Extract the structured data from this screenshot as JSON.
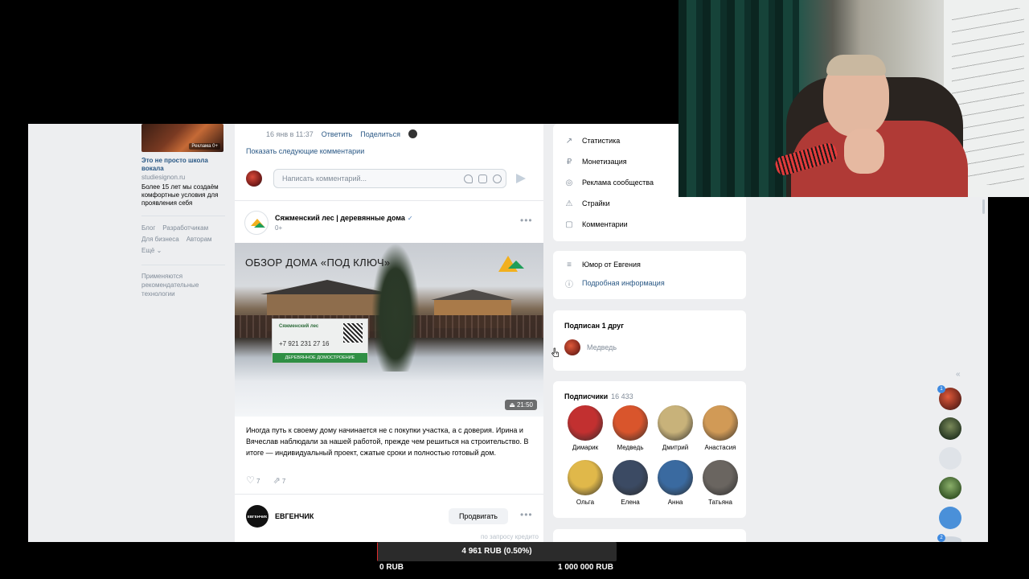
{
  "ad": {
    "badge": "Реклама 0+",
    "title": "Это не просто школа вокала",
    "domain": "studiesignon.ru",
    "description": "Более 15 лет мы создаём комфортные условия для проявления себя"
  },
  "footer_links": [
    "Блог",
    "Разработчикам",
    "Для бизнеса",
    "Авторам",
    "Ещё ⌄"
  ],
  "recommendation_note": "Применяются рекомендательные технологии",
  "comment_meta": {
    "time": "16 янв в 11:37",
    "reply": "Ответить",
    "share": "Поделиться"
  },
  "show_next_comments": "Показать следующие комментарии",
  "comment_placeholder": "Написать комментарий...",
  "post": {
    "author": "Сяжменский лес | деревянные дома",
    "verified_mark": "✓",
    "age_rating": "0+",
    "video_title": "ОБЗОР ДОМА «ПОД КЛЮЧ»",
    "sign_name": "Сяжменский лес",
    "sign_phone": "+7 921 231 27 16",
    "sign_strip": "ДЕРЕВЯННОЕ ДОМОСТРОЕНИЕ",
    "video_duration": "⏏ 21:50",
    "text": "Иногда путь к своему дому начинается не с покупки участка, а с доверия. Ирина и Вячеслав наблюдали за нашей работой, прежде чем решиться на строительство. В итоге — индивидуальный проект, сжатые сроки и полностью готовый дом.",
    "likes": "7",
    "shares": "7"
  },
  "next_post": {
    "avatar_text": "ЕВГЕНЧИК",
    "author": "ЕВГЕНЧИК",
    "promote": "Продвигать",
    "faded_note": "по запросу кредито"
  },
  "community_menu": [
    {
      "icon": "stats-icon",
      "glyph": "↗",
      "label": "Статистика"
    },
    {
      "icon": "monetization-icon",
      "glyph": "₽",
      "label": "Монетизация"
    },
    {
      "icon": "ads-icon",
      "glyph": "◎",
      "label": "Реклама сообщества"
    },
    {
      "icon": "strikes-icon",
      "glyph": "⚠",
      "label": "Страйки"
    },
    {
      "icon": "comments-icon",
      "glyph": "▢",
      "label": "Комментарии"
    }
  ],
  "about": {
    "name": "Юмор от Евгения",
    "details": "Подробная информация"
  },
  "friends": {
    "title": "Подписан 1 друг",
    "friend": "Медведь"
  },
  "subscribers": {
    "title": "Подписчики",
    "count": "16 433",
    "people": [
      {
        "name": "Димарик",
        "color": "#c23030"
      },
      {
        "name": "Медведь",
        "color": "#d9552c"
      },
      {
        "name": "Дмитрий",
        "color": "#c8b27a"
      },
      {
        "name": "Анастасия",
        "color": "#d19a56"
      },
      {
        "name": "Ольга",
        "color": "#e0b84a"
      },
      {
        "name": "Елена",
        "color": "#3b4a63"
      },
      {
        "name": "Анна",
        "color": "#3a6aa0"
      },
      {
        "name": "Татьяна",
        "color": "#6a6560"
      }
    ]
  },
  "rail": {
    "badge_top": "1",
    "badge_bottom": "2",
    "collapse": "«"
  },
  "goal": {
    "current": "4 961 RUB (0.50%)",
    "progress_percent": 0.5,
    "min": "0 RUB",
    "max": "1 000 000 RUB",
    "fill_color": "#e02b2b"
  }
}
